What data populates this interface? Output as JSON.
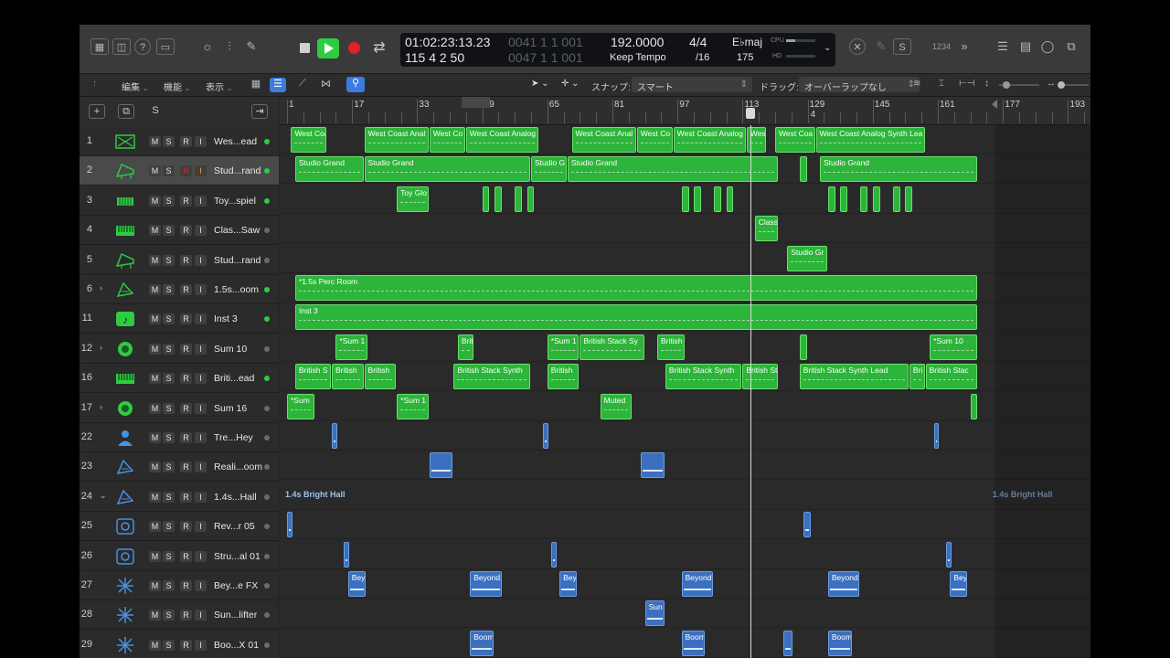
{
  "colors": {
    "accent_green": "#2ecc40",
    "record_red": "#e0202a",
    "region_green": "#2db43a",
    "region_blue": "#3b6fbf",
    "selected_row": "#4a4a4a"
  },
  "toolbar": {
    "left_icons": [
      "library-icon",
      "inspector-icon",
      "help-icon",
      "toolbar-icon",
      "smart-controls-icon",
      "mixer-icon",
      "editors-icon"
    ],
    "right_icons": [
      "list-editors-icon",
      "note-pad-icon",
      "loop-browser-icon",
      "browser-icon"
    ],
    "lcd": {
      "timecode": "01:02:23:13.23",
      "position": "115 4 2 50",
      "tempo": "192.0000",
      "tempo_mode": "Keep Tempo",
      "time_signature": "4/4",
      "division": "/16",
      "key": "E♭maj",
      "key_number": "175",
      "cpu_label": "CPU",
      "hd_label": "HD",
      "ghost1": "0041 1 1 001",
      "ghost2": "0047 1 1 001"
    },
    "count_in": "1234"
  },
  "editbar": {
    "edit": "編集",
    "functions": "機能",
    "view": "表示",
    "snap_label": "スナップ:",
    "snap_value": "スマート",
    "drag_label": "ドラッグ:",
    "drag_value": "オーバーラップなし"
  },
  "header_panel": {
    "s_label": "S"
  },
  "tracks": [
    {
      "num": "1",
      "name": "Wes...ead",
      "icon": "synth-icon",
      "led": "#2ecc40",
      "disclosure": ""
    },
    {
      "num": "2",
      "name": "Stud...rand",
      "icon": "grand-piano-icon",
      "led": "#2ecc40",
      "disclosure": "",
      "selected": true
    },
    {
      "num": "3",
      "name": "Toy...spiel",
      "icon": "glockenspiel-icon",
      "led": "#2ecc40",
      "disclosure": ""
    },
    {
      "num": "4",
      "name": "Clas...Saw",
      "icon": "keyboard-icon",
      "led": "#6a6a6a",
      "disclosure": ""
    },
    {
      "num": "5",
      "name": "Stud...rand",
      "icon": "grand-piano-icon",
      "led": "#6a6a6a",
      "disclosure": ""
    },
    {
      "num": "6",
      "name": "1.5s...oom",
      "icon": "room-icon",
      "led": "#2ecc40",
      "disclosure": ">"
    },
    {
      "num": "11",
      "name": "Inst 3",
      "icon": "instrument-icon",
      "led": "#2ecc40",
      "disclosure": ""
    },
    {
      "num": "12",
      "name": "Sum 10",
      "icon": "summing-icon",
      "led": "#6a6a6a",
      "disclosure": ">"
    },
    {
      "num": "16",
      "name": "Briti...ead",
      "icon": "keyboard-icon",
      "led": "#2ecc40",
      "disclosure": ""
    },
    {
      "num": "17",
      "name": "Sum 16",
      "icon": "summing-icon",
      "led": "#6a6a6a",
      "disclosure": ">"
    },
    {
      "num": "22",
      "name": "Tre...Hey",
      "icon": "vocal-icon",
      "led": "#6a6a6a",
      "disclosure": ""
    },
    {
      "num": "23",
      "name": "Reali...oom",
      "icon": "room-icon",
      "led": "#6a6a6a",
      "disclosure": ""
    },
    {
      "num": "24",
      "name": "1.4s...Hall",
      "icon": "room-icon",
      "led": "#6a6a6a",
      "disclosure": "v"
    },
    {
      "num": "25",
      "name": "Rev...r 05",
      "icon": "speaker-icon",
      "led": "#6a6a6a",
      "disclosure": ""
    },
    {
      "num": "26",
      "name": "Stru...al 01",
      "icon": "speaker-icon",
      "led": "#6a6a6a",
      "disclosure": ""
    },
    {
      "num": "27",
      "name": "Bey...e FX",
      "icon": "fx-burst-icon",
      "led": "#6a6a6a",
      "disclosure": ""
    },
    {
      "num": "28",
      "name": "Sun...lifter",
      "icon": "fx-burst-icon",
      "led": "#6a6a6a",
      "disclosure": ""
    },
    {
      "num": "29",
      "name": "Boo...X 01",
      "icon": "fx-burst-icon",
      "led": "#6a6a6a",
      "disclosure": ""
    }
  ],
  "track_buttons": {
    "mute": "M",
    "solo": "S",
    "record": "R",
    "input": "I"
  },
  "ruler": {
    "bars": [
      "1",
      "17",
      "33",
      "49",
      "65",
      "81",
      "97",
      "113",
      "129",
      "145",
      "161",
      "177",
      "193"
    ],
    "marker": "4"
  },
  "regions": [
    {
      "lane": 0,
      "bar": 2,
      "len": 9,
      "name": "West Coa"
    },
    {
      "lane": 0,
      "bar": 20,
      "len": 16,
      "name": "West Coast Anal"
    },
    {
      "lane": 0,
      "bar": 36,
      "len": 9,
      "name": "West Co"
    },
    {
      "lane": 0,
      "bar": 45,
      "len": 18,
      "name": "West Coast Analog"
    },
    {
      "lane": 0,
      "bar": 71,
      "len": 16,
      "name": "West Coast Anal"
    },
    {
      "lane": 0,
      "bar": 87,
      "len": 9,
      "name": "West Co"
    },
    {
      "lane": 0,
      "bar": 96,
      "len": 18,
      "name": "West Coast Analog"
    },
    {
      "lane": 0,
      "bar": 114,
      "len": 5,
      "name": "Wes"
    },
    {
      "lane": 0,
      "bar": 121,
      "len": 10,
      "name": "West Coa"
    },
    {
      "lane": 0,
      "bar": 131,
      "len": 27,
      "name": "West Coast Analog Synth Lea"
    },
    {
      "lane": 1,
      "bar": 3,
      "len": 17,
      "name": "Studio Grand"
    },
    {
      "lane": 1,
      "bar": 20,
      "len": 41,
      "name": "Studio Grand"
    },
    {
      "lane": 1,
      "bar": 61,
      "len": 9,
      "name": "Studio G"
    },
    {
      "lane": 1,
      "bar": 70,
      "len": 52,
      "name": "Studio Grand"
    },
    {
      "lane": 1,
      "bar": 127,
      "len": 2,
      "name": ""
    },
    {
      "lane": 1,
      "bar": 132,
      "len": 39,
      "name": "Studio Grand"
    },
    {
      "lane": 2,
      "bar": 28,
      "len": 8,
      "name": "Toy Glo"
    },
    {
      "lane": 2,
      "bar": 49,
      "len": 2,
      "name": ""
    },
    {
      "lane": 2,
      "bar": 52,
      "len": 2,
      "name": ""
    },
    {
      "lane": 2,
      "bar": 57,
      "len": 2,
      "name": ""
    },
    {
      "lane": 2,
      "bar": 60,
      "len": 2,
      "name": ""
    },
    {
      "lane": 2,
      "bar": 98,
      "len": 2,
      "name": ""
    },
    {
      "lane": 2,
      "bar": 101,
      "len": 2,
      "name": ""
    },
    {
      "lane": 2,
      "bar": 106,
      "len": 2,
      "name": ""
    },
    {
      "lane": 2,
      "bar": 109,
      "len": 2,
      "name": ""
    },
    {
      "lane": 2,
      "bar": 134,
      "len": 2,
      "name": ""
    },
    {
      "lane": 2,
      "bar": 137,
      "len": 2,
      "name": ""
    },
    {
      "lane": 2,
      "bar": 142,
      "len": 2,
      "name": ""
    },
    {
      "lane": 2,
      "bar": 145,
      "len": 2,
      "name": ""
    },
    {
      "lane": 2,
      "bar": 150,
      "len": 2,
      "name": ""
    },
    {
      "lane": 2,
      "bar": 153,
      "len": 2,
      "name": ""
    },
    {
      "lane": 3,
      "bar": 116,
      "len": 6,
      "name": "Class"
    },
    {
      "lane": 4,
      "bar": 124,
      "len": 10,
      "name": "Studio Gr"
    },
    {
      "lane": 5,
      "bar": 3,
      "len": 168,
      "name": "*1.5s Perc Room"
    },
    {
      "lane": 6,
      "bar": 3,
      "len": 168,
      "name": "Inst 3"
    },
    {
      "lane": 7,
      "bar": 13,
      "len": 8,
      "name": "*Sum 1"
    },
    {
      "lane": 7,
      "bar": 43,
      "len": 4,
      "name": "Briti"
    },
    {
      "lane": 7,
      "bar": 65,
      "len": 8,
      "name": "*Sum 1"
    },
    {
      "lane": 7,
      "bar": 73,
      "len": 16,
      "name": "British Stack Sy"
    },
    {
      "lane": 7,
      "bar": 92,
      "len": 7,
      "name": "British"
    },
    {
      "lane": 7,
      "bar": 127,
      "len": 2,
      "name": ""
    },
    {
      "lane": 7,
      "bar": 159,
      "len": 12,
      "name": "*Sum 10"
    },
    {
      "lane": 8,
      "bar": 3,
      "len": 9,
      "name": "British S"
    },
    {
      "lane": 8,
      "bar": 12,
      "len": 8,
      "name": "British"
    },
    {
      "lane": 8,
      "bar": 20,
      "len": 8,
      "name": "British"
    },
    {
      "lane": 8,
      "bar": 42,
      "len": 19,
      "name": "British Stack Synth"
    },
    {
      "lane": 8,
      "bar": 65,
      "len": 8,
      "name": "British"
    },
    {
      "lane": 8,
      "bar": 94,
      "len": 19,
      "name": "British Stack Synth"
    },
    {
      "lane": 8,
      "bar": 113,
      "len": 9,
      "name": "British St"
    },
    {
      "lane": 8,
      "bar": 127,
      "len": 27,
      "name": "British Stack Synth Lead"
    },
    {
      "lane": 8,
      "bar": 154,
      "len": 4,
      "name": "Bri"
    },
    {
      "lane": 8,
      "bar": 158,
      "len": 13,
      "name": "British Stac"
    },
    {
      "lane": 9,
      "bar": 1,
      "len": 7,
      "name": "*Sum"
    },
    {
      "lane": 9,
      "bar": 28,
      "len": 8,
      "name": "*Sum 1"
    },
    {
      "lane": 9,
      "bar": 78,
      "len": 8,
      "name": "Muted"
    },
    {
      "lane": 9,
      "bar": 169,
      "len": 2,
      "name": ""
    }
  ],
  "audio_regions": [
    {
      "lane": 10,
      "bar": 12,
      "len": 1.5,
      "name": ""
    },
    {
      "lane": 10,
      "bar": 64,
      "len": 1.5,
      "name": ""
    },
    {
      "lane": 10,
      "bar": 160,
      "len": 1.5,
      "name": ""
    },
    {
      "lane": 11,
      "bar": 36,
      "len": 6,
      "name": ""
    },
    {
      "lane": 11,
      "bar": 88,
      "len": 6,
      "name": ""
    },
    {
      "lane": 13,
      "bar": 1,
      "len": 1.5,
      "name": ""
    },
    {
      "lane": 13,
      "bar": 128,
      "len": 2,
      "name": ""
    },
    {
      "lane": 14,
      "bar": 15,
      "len": 1.5,
      "name": ""
    },
    {
      "lane": 14,
      "bar": 66,
      "len": 1.5,
      "name": ""
    },
    {
      "lane": 14,
      "bar": 163,
      "len": 1.5,
      "name": ""
    },
    {
      "lane": 15,
      "bar": 16,
      "len": 4.5,
      "name": "Bey"
    },
    {
      "lane": 15,
      "bar": 46,
      "len": 8,
      "name": "Beyond"
    },
    {
      "lane": 15,
      "bar": 68,
      "len": 4.5,
      "name": "Bey"
    },
    {
      "lane": 15,
      "bar": 98,
      "len": 8,
      "name": "Beyond"
    },
    {
      "lane": 15,
      "bar": 134,
      "len": 8,
      "name": "Beyond"
    },
    {
      "lane": 15,
      "bar": 164,
      "len": 4.5,
      "name": "Bey"
    },
    {
      "lane": 16,
      "bar": 89,
      "len": 5,
      "name": "Sun"
    },
    {
      "lane": 17,
      "bar": 46,
      "len": 6,
      "name": "Boom"
    },
    {
      "lane": 17,
      "bar": 98,
      "len": 6,
      "name": "Boom"
    },
    {
      "lane": 17,
      "bar": 123,
      "len": 2.5,
      "name": ""
    },
    {
      "lane": 17,
      "bar": 134,
      "len": 6,
      "name": "Boom"
    }
  ],
  "bus_label": "1.4s Bright Hall",
  "playhead_bar": 115
}
